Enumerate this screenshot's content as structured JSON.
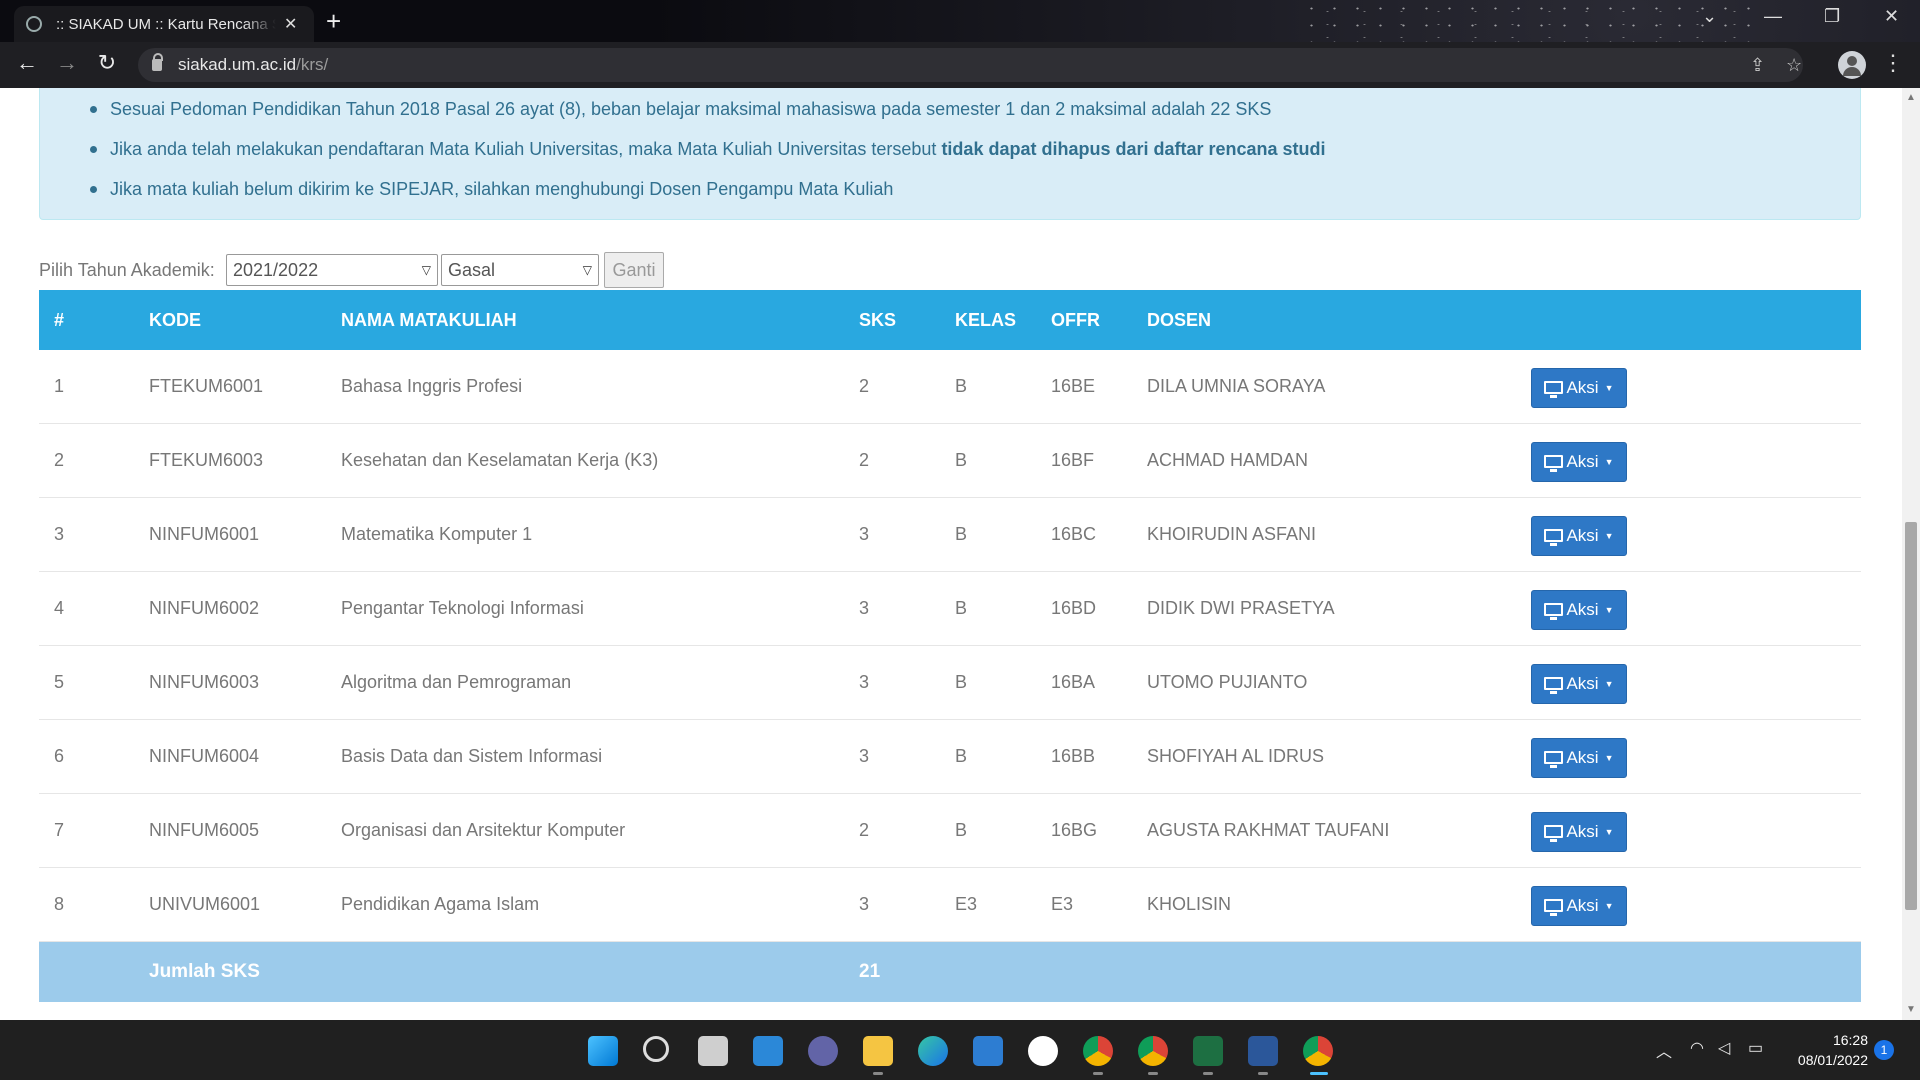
{
  "browser": {
    "tab_title": ":: SIAKAD UM :: Kartu Rencana Studi",
    "tab_close": "✕",
    "new_tab": "+",
    "url_domain": "siakad.um.ac.id",
    "url_path": "/krs/",
    "icons": [
      "back-icon",
      "forward-icon",
      "reload-icon",
      "lock-icon",
      "share-icon",
      "star-icon",
      "profile-icon",
      "menu-icon"
    ]
  },
  "info": {
    "item1": "Sesuai Pedoman Pendidikan Tahun 2018 Pasal 26 ayat (8), beban belajar maksimal mahasiswa pada semester 1 dan 2 maksimal adalah 22 SKS",
    "item2_prefix": "Jika anda telah melakukan pendaftaran Mata Kuliah Universitas, maka Mata Kuliah Universitas tersebut ",
    "item2_bold": "tidak dapat dihapus dari daftar rencana studi",
    "item3": "Jika mata kuliah belum dikirim ke SIPEJAR, silahkan menghubungi Dosen Pengampu Mata Kuliah"
  },
  "filter": {
    "label": "Pilih Tahun Akademik:",
    "year": "2021/2022",
    "semester": "Gasal",
    "button": "Ganti"
  },
  "table": {
    "headers": {
      "no": "#",
      "kode": "KODE",
      "nama": "NAMA MATAKULIAH",
      "sks": "SKS",
      "kelas": "KELAS",
      "offr": "OFFR",
      "dosen": "DOSEN"
    },
    "action_label": "Aksi",
    "rows": [
      {
        "no": "1",
        "kode": "FTEKUM6001",
        "nama": "Bahasa Inggris Profesi",
        "sks": "2",
        "kelas": "B",
        "offr": "16BE",
        "dosen": "DILA UMNIA SORAYA"
      },
      {
        "no": "2",
        "kode": "FTEKUM6003",
        "nama": "Kesehatan dan Keselamatan Kerja (K3)",
        "sks": "2",
        "kelas": "B",
        "offr": "16BF",
        "dosen": "ACHMAD HAMDAN"
      },
      {
        "no": "3",
        "kode": "NINFUM6001",
        "nama": "Matematika Komputer 1",
        "sks": "3",
        "kelas": "B",
        "offr": "16BC",
        "dosen": "KHOIRUDIN ASFANI"
      },
      {
        "no": "4",
        "kode": "NINFUM6002",
        "nama": "Pengantar Teknologi Informasi",
        "sks": "3",
        "kelas": "B",
        "offr": "16BD",
        "dosen": "DIDIK DWI PRASETYA"
      },
      {
        "no": "5",
        "kode": "NINFUM6003",
        "nama": "Algoritma dan Pemrograman",
        "sks": "3",
        "kelas": "B",
        "offr": "16BA",
        "dosen": "UTOMO PUJIANTO"
      },
      {
        "no": "6",
        "kode": "NINFUM6004",
        "nama": "Basis Data dan Sistem Informasi",
        "sks": "3",
        "kelas": "B",
        "offr": "16BB",
        "dosen": "SHOFIYAH AL IDRUS"
      },
      {
        "no": "7",
        "kode": "NINFUM6005",
        "nama": "Organisasi dan Arsitektur Komputer",
        "sks": "2",
        "kelas": "B",
        "offr": "16BG",
        "dosen": "AGUSTA RAKHMAT TAUFANI"
      },
      {
        "no": "8",
        "kode": "UNIVUM6001",
        "nama": "Pendidikan Agama Islam",
        "sks": "3",
        "kelas": "E3",
        "offr": "E3",
        "dosen": "KHOLISIN"
      }
    ],
    "footer_label": "Jumlah SKS",
    "footer_total": "21"
  },
  "taskbar": {
    "time": "16:28",
    "date": "08/01/2022",
    "notification_count": "1"
  },
  "colors": {
    "header_bg": "#29a8e0",
    "footer_bg": "#9ccbeb",
    "info_bg": "#d9edf7",
    "info_text": "#31708f",
    "action_btn": "#2e78c6"
  }
}
